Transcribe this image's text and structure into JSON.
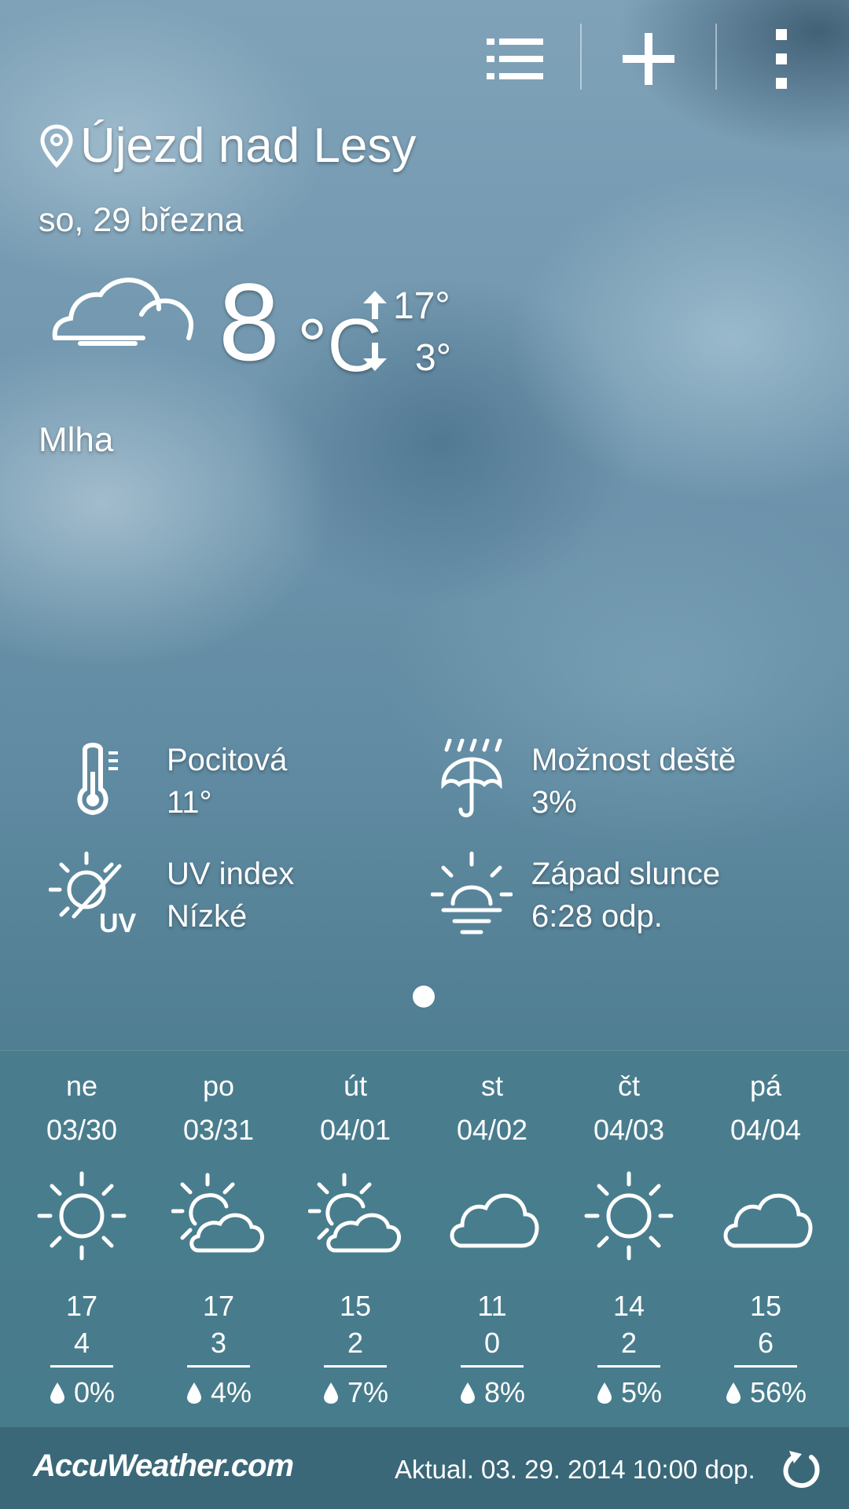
{
  "location": {
    "name": "Újezd nad Lesy"
  },
  "date": "so, 29 března",
  "current": {
    "temp": "8",
    "unit": "°C",
    "high": "17°",
    "low": "3°",
    "condition": "Mlha",
    "condition_icon": "cloud-icon"
  },
  "details": [
    {
      "label": "Pocitová",
      "value": "11°",
      "icon": "thermometer-icon"
    },
    {
      "label": "Možnost deště",
      "value": "3%",
      "icon": "umbrella-rain-icon"
    },
    {
      "label": "UV index",
      "value": "Nízké",
      "icon": "uv-sun-icon"
    },
    {
      "label": "Západ slunce",
      "value": "6:28 odp.",
      "icon": "sunset-icon"
    }
  ],
  "forecast": [
    {
      "day": "ne",
      "date": "03/30",
      "icon": "sunny",
      "high": "17",
      "low": "4",
      "rain": "0%"
    },
    {
      "day": "po",
      "date": "03/31",
      "icon": "partly-cloudy",
      "high": "17",
      "low": "3",
      "rain": "4%"
    },
    {
      "day": "út",
      "date": "04/01",
      "icon": "partly-cloudy",
      "high": "15",
      "low": "2",
      "rain": "7%"
    },
    {
      "day": "st",
      "date": "04/02",
      "icon": "cloudy",
      "high": "11",
      "low": "0",
      "rain": "8%"
    },
    {
      "day": "čt",
      "date": "04/03",
      "icon": "sunny",
      "high": "14",
      "low": "2",
      "rain": "5%"
    },
    {
      "day": "pá",
      "date": "04/04",
      "icon": "cloudy",
      "high": "15",
      "low": "6",
      "rain": "56%"
    }
  ],
  "footer": {
    "brand": "AccuWeather.com",
    "updated": "Aktual. 03. 29. 2014 10:00 dop."
  },
  "page_indicator": {
    "current": 1,
    "total": 1
  }
}
